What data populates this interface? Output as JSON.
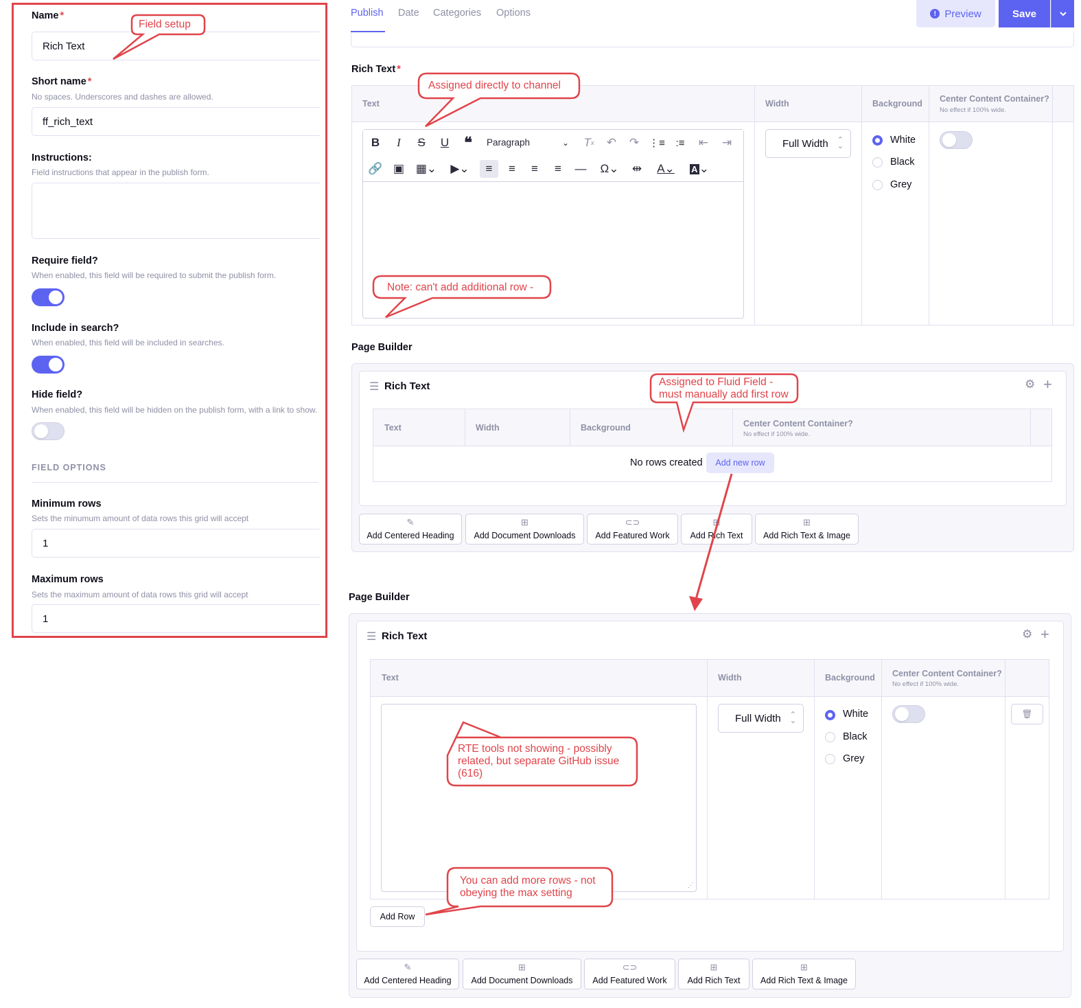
{
  "setup": {
    "name_label": "Name",
    "name_value": "Rich Text",
    "short_name_label": "Short name",
    "short_name_desc": "No spaces. Underscores and dashes are allowed.",
    "short_name_value": "ff_rich_text",
    "instructions_label": "Instructions:",
    "instructions_desc": "Field instructions that appear in the publish form.",
    "instructions_value": "",
    "require_label": "Require field?",
    "require_desc": "When enabled, this field will be required to submit the publish form.",
    "require_on": true,
    "search_label": "Include in search?",
    "search_desc": "When enabled, this field will be included in searches.",
    "search_on": true,
    "hide_label": "Hide field?",
    "hide_desc": "When enabled, this field will be hidden on the publish form, with a link to show.",
    "hide_on": false,
    "field_options_title": "FIELD OPTIONS",
    "min_rows_label": "Minimum rows",
    "min_rows_desc": "Sets the minumum amount of data rows this grid will accept",
    "min_rows_value": "1",
    "max_rows_label": "Maximum rows",
    "max_rows_desc": "Sets the maximum amount of data rows this grid will accept",
    "max_rows_value": "1",
    "required_mark": "*"
  },
  "tabs": [
    "Publish",
    "Date",
    "Categories",
    "Options"
  ],
  "header": {
    "preview_label": "Preview",
    "save_label": "Save",
    "accent": "#5d63f1"
  },
  "rich_text_field": {
    "label": "Rich Text",
    "required_mark": "*",
    "columns": {
      "text": "Text",
      "width": "Width",
      "background": "Background",
      "center": "Center Content Container?",
      "center_sub": "No effect if 100% wide."
    },
    "toolbar": {
      "paragraph": "Paragraph"
    },
    "width_value": "Full Width",
    "bg_options": [
      "White",
      "Black",
      "Grey"
    ],
    "bg_selected": "White"
  },
  "page_builder_1": {
    "label": "Page Builder",
    "block_title": "Rich Text",
    "columns": [
      "Text",
      "Width",
      "Background",
      "Center Content Container?"
    ],
    "center_sub": "No effect if 100% wide.",
    "no_rows": "No rows created",
    "add_new_row": "Add new row",
    "add_buttons": [
      "Add Centered Heading",
      "Add Document Downloads",
      "Add Featured Work",
      "Add Rich Text",
      "Add Rich Text & Image"
    ]
  },
  "page_builder_2": {
    "label": "Page Builder",
    "block_title": "Rich Text",
    "columns": [
      "Text",
      "Width",
      "Background",
      "Center Content Container?"
    ],
    "center_sub": "No effect if 100% wide.",
    "width_value": "Full Width",
    "bg_options": [
      "White",
      "Black",
      "Grey"
    ],
    "add_row": "Add Row",
    "add_buttons": [
      "Add Centered Heading",
      "Add Document Downloads",
      "Add Featured Work",
      "Add Rich Text",
      "Add Rich Text & Image"
    ]
  },
  "annotations": {
    "field_setup": "Field setup",
    "assigned_channel": "Assigned directly to channel",
    "note_row": "Note: can't add additional row -",
    "fluid_1": "Assigned to Fluid Field -",
    "fluid_2": "must manually add first row",
    "rte_1": "RTE tools not showing - possibly",
    "rte_2": "related, but separate GitHub issue",
    "rte_3": "(616)",
    "more_1": "You can add more rows - not",
    "more_2": "obeying the max setting",
    "color": "#e0444a"
  }
}
